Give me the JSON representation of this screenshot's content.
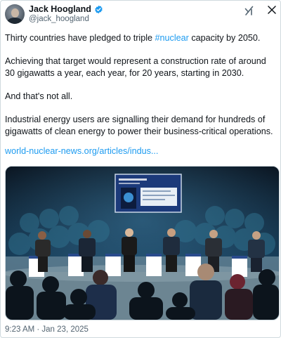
{
  "author": {
    "name": "Jack Hoogland",
    "handle": "@jack_hoogland",
    "verified": true
  },
  "header_icons": [
    "grok-icon",
    "close-icon"
  ],
  "tweet": {
    "hashtag_prefix": "Thirty countries have pledged to triple ",
    "hashtag": "#nuclear",
    "hashtag_suffix": " capacity by 2050.",
    "paragraph_2": "Achieving that target would represent a construction rate of around 30 gigawatts a year, each year, for 20 years, starting in 2030.",
    "paragraph_3": "And that's not all.",
    "paragraph_4": "Industrial energy users are signalling their demand for hundreds of gigawatts of clean energy to power their business-critical operations.",
    "link": "world-nuclear-news.org/articles/indus..."
  },
  "timestamp": "9:23 AM · Jan 23, 2025",
  "colors": {
    "link_blue": "#1d9bf0",
    "text": "#0f1419",
    "secondary": "#536471",
    "stage_bg": "#123047"
  }
}
